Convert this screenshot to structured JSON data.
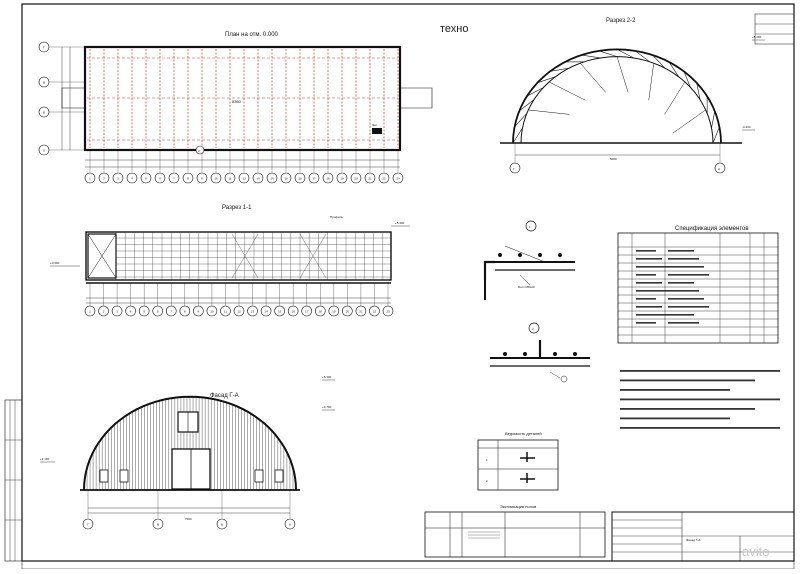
{
  "brand": "техно",
  "watermark": "avito",
  "plan": {
    "title": "План на отм. 0.000",
    "axes_rows": [
      "Г",
      "В",
      "Б",
      "А"
    ],
    "axes_cols": [
      "1",
      "2",
      "3",
      "4",
      "5",
      "6",
      "7",
      "8",
      "9",
      "10",
      "11",
      "12",
      "13",
      "14",
      "15",
      "16",
      "17",
      "18",
      "19",
      "20",
      "21",
      "22",
      "23"
    ],
    "dim_length": "8360"
  },
  "section22": {
    "title": "Разрез 2-2",
    "axis_left": "Г",
    "axis_right": "А",
    "span": "5000"
  },
  "section11": {
    "title": "Разрез 1-1",
    "axes": [
      "1",
      "2",
      "3",
      "4",
      "5",
      "6",
      "7",
      "8",
      "9",
      "10",
      "11",
      "12",
      "13",
      "14",
      "15",
      "16",
      "17",
      "18",
      "19",
      "20",
      "21",
      "22",
      "23"
    ]
  },
  "facade": {
    "title": "Фасад Г-А",
    "axes": [
      "Г",
      "В",
      "Б",
      "А"
    ],
    "span": "7000"
  },
  "nodes": {
    "node1": "1",
    "node2": "2"
  },
  "spec": {
    "title": "Спецификация элементов"
  },
  "details": {
    "title": "Ведомость деталей",
    "rows": [
      "1",
      "2"
    ]
  },
  "explication": {
    "title": "Экспликация полов"
  },
  "title_block": {
    "sheet_name": "Фасад Г-А"
  }
}
